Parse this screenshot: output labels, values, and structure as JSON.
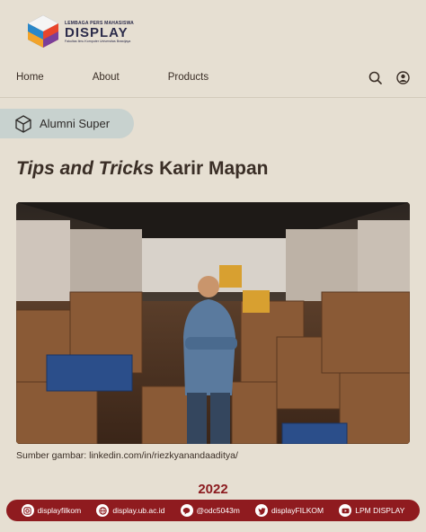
{
  "logo": {
    "top_text": "LEMBAGA PERS MAHASISWA",
    "main_text": "DISPLAY",
    "sub_text": "Fakultas Ilmu Komputer Universitas Brawijaya"
  },
  "nav": {
    "items": [
      {
        "label": "Home"
      },
      {
        "label": "About"
      },
      {
        "label": "Products"
      }
    ],
    "search_icon": "search-icon",
    "account_icon": "user-icon"
  },
  "badge": {
    "label": "Alumni Super",
    "icon": "hexagon-cube-icon"
  },
  "article": {
    "title_italic": "Tips and Tricks",
    "title_rest": " Karir Mapan",
    "caption": "Sumber gambar: linkedin.com/in/riezkyanandaaditya/",
    "year": "2022"
  },
  "footer": {
    "items": [
      {
        "icon": "instagram-icon",
        "label": "displayfilkom"
      },
      {
        "icon": "globe-icon",
        "label": "display.ub.ac.id"
      },
      {
        "icon": "line-icon",
        "label": "@odc5043m"
      },
      {
        "icon": "twitter-icon",
        "label": "displayFILKOM"
      },
      {
        "icon": "youtube-icon",
        "label": "LPM DISPLAY"
      }
    ]
  },
  "colors": {
    "background": "#e6dfd2",
    "accent": "#8f1b1f",
    "badge": "#c8d2cf",
    "text": "#3a2e26"
  }
}
